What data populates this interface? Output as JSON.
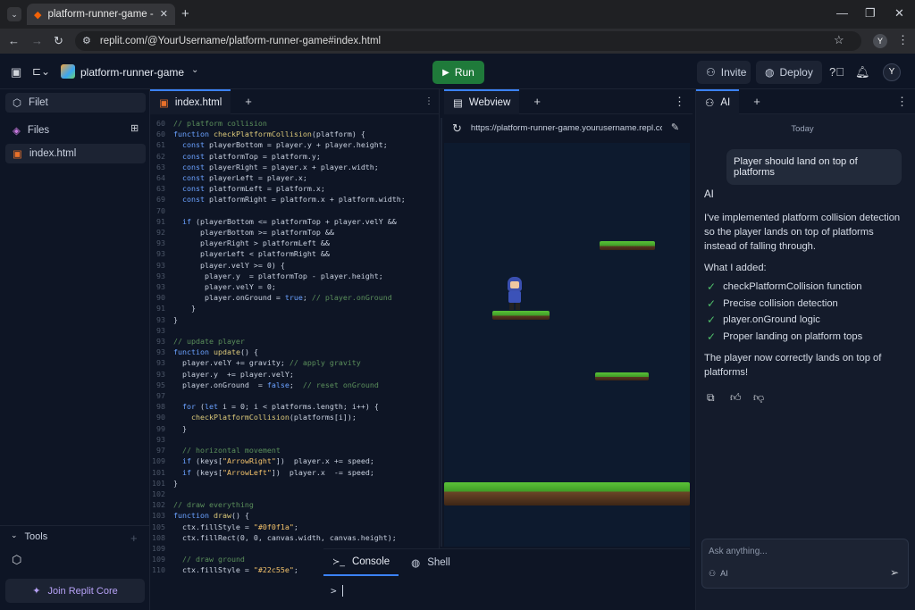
{
  "browser": {
    "tab_title": "platform-runner-game - Replit",
    "url": "replit.com/@YourUsername/platform-runner-game#index.html",
    "profile_initial": "Y"
  },
  "header": {
    "project_name": "platform-runner-game",
    "run_label": "Run",
    "invite_label": "Invite",
    "deploy_label": "Deploy",
    "avatar_initial": "Y"
  },
  "sidebar": {
    "files_tab": "Filet",
    "files_header": "Files",
    "file_item": "index.html",
    "tools_label": "Tools",
    "join_label": "Join Replit Core"
  },
  "editor": {
    "tab_label": "index.html",
    "lines": [
      {
        "n": "60",
        "html": "<span class='c'>// platform collision</span>"
      },
      {
        "n": "60",
        "html": "<span class='k'>function</span> <span class='f'>checkPlatformCollision</span>(platform) {"
      },
      {
        "n": "61",
        "html": "  <span class='k'>const</span> playerBottom = player.y + player.height;"
      },
      {
        "n": "62",
        "html": "  <span class='k'>const</span> platformTop = platform.y;"
      },
      {
        "n": "63",
        "html": "  <span class='k'>const</span> playerRight = player.x + player.width;"
      },
      {
        "n": "64",
        "html": "  <span class='k'>const</span> playerLeft = player.x;"
      },
      {
        "n": "63",
        "html": "  <span class='k'>const</span> platformLeft = platform.x;"
      },
      {
        "n": "69",
        "html": "  <span class='k'>const</span> platformRight = platform.x + platform.width;"
      },
      {
        "n": "70",
        "html": ""
      },
      {
        "n": "91",
        "html": "  <span class='k'>if</span> (playerBottom &lt;= platformTop + player.velY &amp;&amp;"
      },
      {
        "n": "92",
        "html": "      playerBottom &gt;= platformTop &amp;&amp;"
      },
      {
        "n": "93",
        "html": "      playerRight &gt; platformLeft &amp;&amp;"
      },
      {
        "n": "93",
        "html": "      playerLeft &lt; platformRight &amp;&amp;"
      },
      {
        "n": "93",
        "html": "      player.velY &gt;= 0) {"
      },
      {
        "n": "93",
        "html": "       player.y  = platformTop - player.height;"
      },
      {
        "n": "93",
        "html": "       player.velY = 0;"
      },
      {
        "n": "90",
        "html": "       player.onGround = <span class='k'>true</span>; <span class='c'>// player.onGround</span>"
      },
      {
        "n": "91",
        "html": "    }"
      },
      {
        "n": "93",
        "html": "}"
      },
      {
        "n": "93",
        "html": ""
      },
      {
        "n": "93",
        "html": "<span class='c'>// update player</span>"
      },
      {
        "n": "93",
        "html": "<span class='k'>function</span> <span class='f'>update</span>() {"
      },
      {
        "n": "93",
        "html": "  player.velY += gravity; <span class='c'>// apply gravity</span>"
      },
      {
        "n": "93",
        "html": "  player.y  += player.velY;"
      },
      {
        "n": "95",
        "html": "  player.onGround  = <span class='k'>false</span>;  <span class='c'>// reset onGround</span>"
      },
      {
        "n": "97",
        "html": ""
      },
      {
        "n": "98",
        "html": "  <span class='k'>for</span> (<span class='k'>let</span> i = 0; i &lt; platforms.length; i++) {"
      },
      {
        "n": "90",
        "html": "    <span class='f'>checkPlatformCollision</span>(platforms[i]);"
      },
      {
        "n": "99",
        "html": "  }"
      },
      {
        "n": "93",
        "html": ""
      },
      {
        "n": "97",
        "html": "  <span class='c'>// horizontal movement</span>"
      },
      {
        "n": "109",
        "html": "  <span class='k'>if</span> (keys[<span class='s'>\"ArrowRight\"</span>])  player.x += speed;"
      },
      {
        "n": "101",
        "html": "  <span class='k'>if</span> (keys[<span class='s'>\"ArrowLeft\"</span>])  player.x  -= speed;"
      },
      {
        "n": "101",
        "html": "}"
      },
      {
        "n": "102",
        "html": ""
      },
      {
        "n": "102",
        "html": "<span class='c'>// draw everything</span>"
      },
      {
        "n": "103",
        "html": "<span class='k'>function</span> <span class='f'>draw</span>() {"
      },
      {
        "n": "105",
        "html": "  ctx.fillStyle = <span class='s'>\"#0f0f1a\"</span>;"
      },
      {
        "n": "108",
        "html": "  ctx.fillRect(0, 0, canvas.width, canvas.height);"
      },
      {
        "n": "109",
        "html": ""
      },
      {
        "n": "109",
        "html": "  <span class='c'>// draw ground</span>"
      },
      {
        "n": "110",
        "html": "  ctx.fillStyle = <span class='s'>\"#22c55e\"</span>;"
      }
    ]
  },
  "webview": {
    "tab_label": "Webview",
    "url": "https://platform-runner-game.yourusername.repl.co"
  },
  "console": {
    "console_tab": "Console",
    "shell_tab": "Shell",
    "prompt": ">"
  },
  "ai": {
    "tab_label": "AI",
    "date_label": "Today",
    "user_message": "Player should land on top of platforms",
    "sender": "AI",
    "reply_intro": "I've implemented platform collision detection so the player lands on top of platforms instead of falling through.",
    "added_header": "What I added:",
    "added_items": [
      "checkPlatformCollision function",
      "Precise collision detection",
      "player.onGround logic",
      "Proper landing on platform tops"
    ],
    "reply_outro": "The player now correctly lands on top of platforms!",
    "input_placeholder": "Ask anything...",
    "mode_label": "AI"
  },
  "colors": {
    "run_green": "#1f7a3a",
    "grass": "#5bc238",
    "accent": "#3b82f6"
  }
}
